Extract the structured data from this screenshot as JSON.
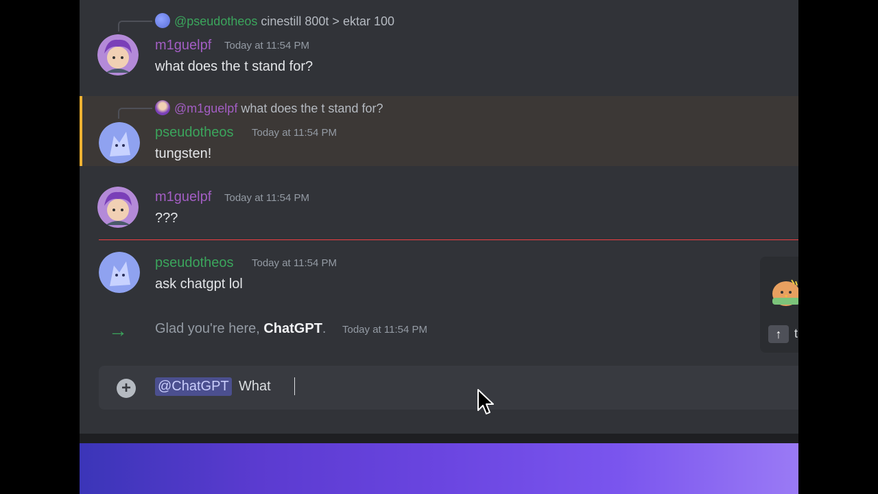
{
  "messages": [
    {
      "reply_to": {
        "name": "@pseudotheos",
        "text": "cinestill 800t > ektar 100"
      },
      "author": "m1guelpf",
      "timestamp": "Today at 11:54 PM",
      "text": "what does the t stand for?"
    },
    {
      "reply_to": {
        "name": "@m1guelpf",
        "text": "what does the t stand for?"
      },
      "author": "pseudotheos",
      "timestamp": "Today at 11:54 PM",
      "text": "tungsten!"
    },
    {
      "author": "m1guelpf",
      "timestamp": "Today at 11:54 PM",
      "text": "???"
    },
    {
      "author": "pseudotheos",
      "timestamp": "Today at 11:54 PM",
      "text": "ask chatgpt lol"
    }
  ],
  "join_message": {
    "prefix": "Glad you're here, ",
    "user": "ChatGPT",
    "suffix": ".",
    "timestamp": "Today at 11:54 PM"
  },
  "composer": {
    "mention": "@ChatGPT",
    "typed_text": "What",
    "add_icon": "plus-circle-icon"
  },
  "side_popup": {
    "up_icon": "arrow-up-icon",
    "partial_text": "t"
  },
  "colors": {
    "panel_bg": "#313338",
    "name_purple": "#a35ec4",
    "name_green": "#3ba55c",
    "highlight_border": "#f0b232",
    "new_divider": "#f23f43"
  }
}
